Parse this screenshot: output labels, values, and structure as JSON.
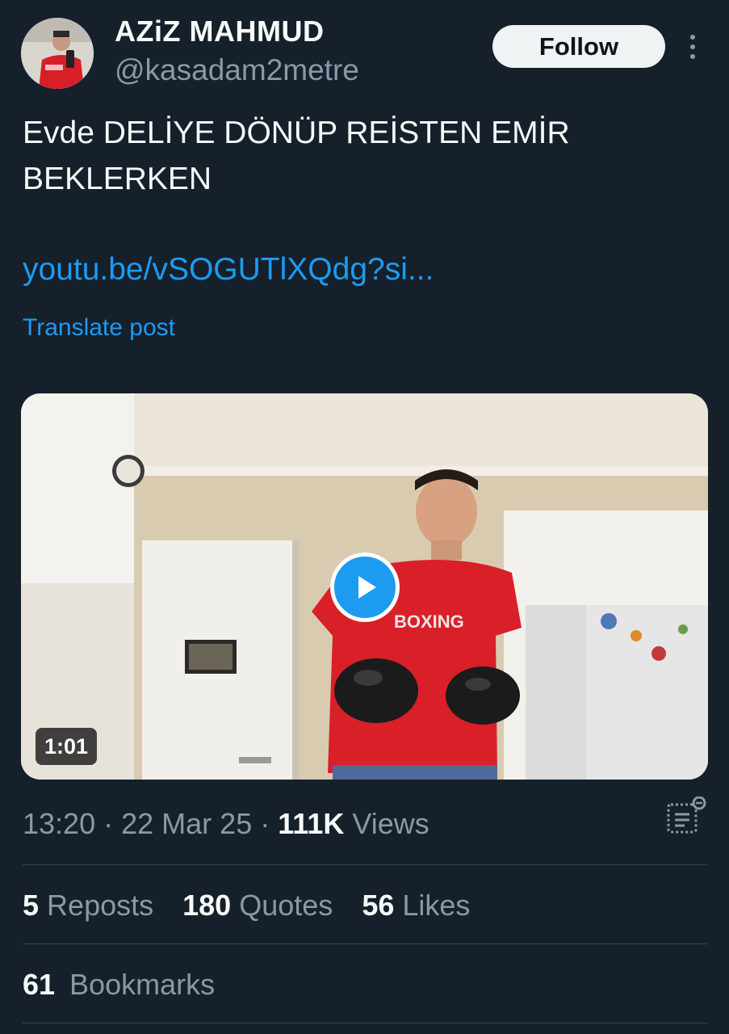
{
  "author": {
    "display_name": "AZiZ MAHMUD",
    "handle": "@kasadam2metre",
    "avatar_icon": "profile-photo"
  },
  "follow_label": "Follow",
  "post": {
    "text": "Evde DELİYE DÖNÜP REİSTEN EMİR BEKLERKEN",
    "link": "youtu.be/vSOGUTlXQdg?si...",
    "translate_label": "Translate post"
  },
  "media": {
    "duration": "1:01",
    "shirt_text": "BOXING",
    "play_icon": "play-icon"
  },
  "meta": {
    "time": "13:20",
    "date": "22 Mar 25",
    "views_count": "111K",
    "views_label": "Views",
    "separator": "·"
  },
  "stats": {
    "reposts_count": "5",
    "reposts_label": "Reposts",
    "quotes_count": "180",
    "quotes_label": "Quotes",
    "likes_count": "56",
    "likes_label": "Likes",
    "bookmarks_count": "61",
    "bookmarks_label": "Bookmarks"
  },
  "colors": {
    "background": "#15202b",
    "accent": "#1d9bf0",
    "secondary_text": "#8b98a5",
    "divider": "#38444d"
  }
}
